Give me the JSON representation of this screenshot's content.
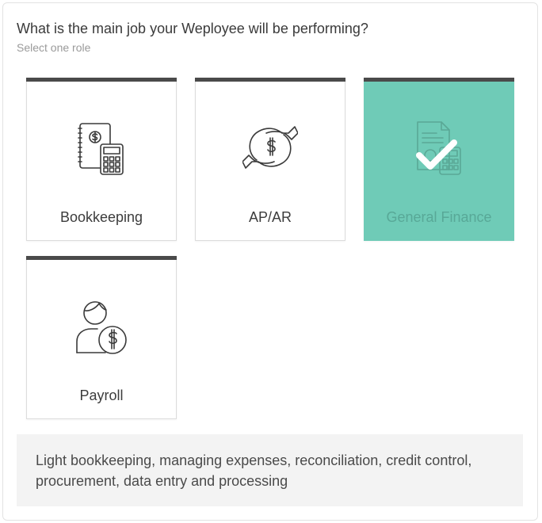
{
  "question": {
    "title": "What is the main job your Weployee will be performing?",
    "subtitle": "Select one role"
  },
  "roles": [
    {
      "label": "Bookkeeping",
      "icon": "ledger-calculator-icon",
      "selected": false
    },
    {
      "label": "AP/AR",
      "icon": "dollar-exchange-icon",
      "selected": false
    },
    {
      "label": "General Finance",
      "icon": "document-calculator-icon",
      "selected": true
    },
    {
      "label": "Payroll",
      "icon": "person-dollar-icon",
      "selected": false
    }
  ],
  "description": "Light bookkeeping, managing expenses, reconciliation, credit control, procurement, data entry and processing",
  "colors": {
    "selected_bg": "#6fcbb7",
    "card_top_bar": "#4a4a4a",
    "description_bg": "#f3f3f3"
  }
}
